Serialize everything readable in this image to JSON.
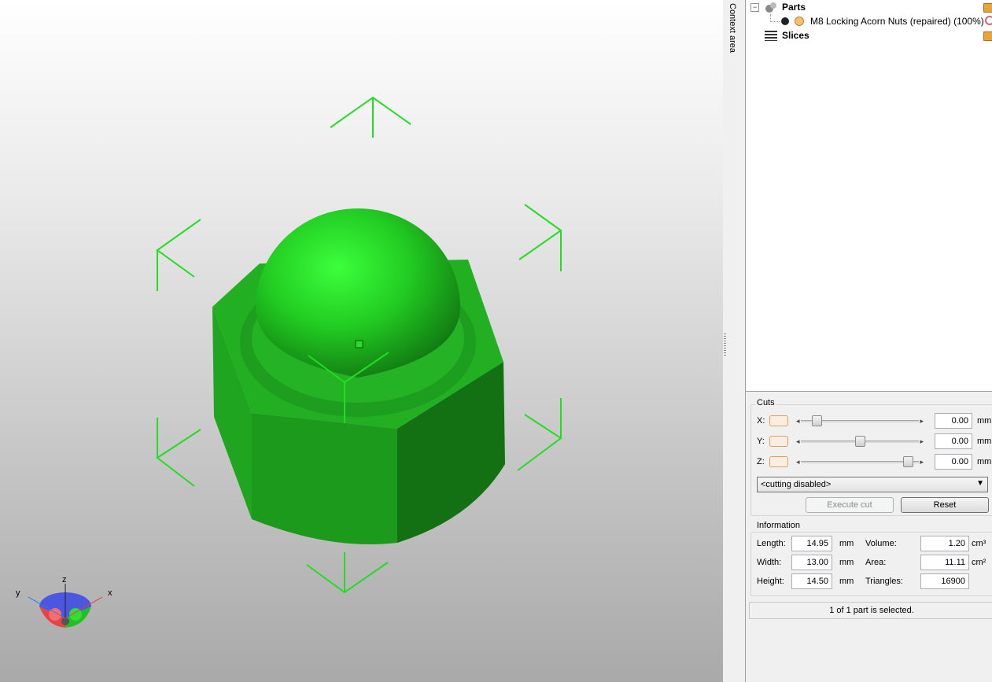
{
  "context_area_label": "Context area",
  "tree": {
    "parts_label": "Parts",
    "part_item": "M8 Locking Acorn Nuts (repaired) (100%)",
    "slices_label": "Slices",
    "expander_symbol": "−"
  },
  "cuts": {
    "title": "Cuts",
    "axes": [
      {
        "label": "X:",
        "value": "0.00",
        "unit": "mm",
        "slider_position": 0.1
      },
      {
        "label": "Y:",
        "value": "0.00",
        "unit": "mm",
        "slider_position": 0.5
      },
      {
        "label": "Z:",
        "value": "0.00",
        "unit": "mm",
        "slider_position": 0.95
      }
    ],
    "mode_select": "<cutting disabled>",
    "execute_label": "Execute cut",
    "reset_label": "Reset"
  },
  "information": {
    "title": "Information",
    "length_label": "Length:",
    "length_value": "14.95",
    "length_unit": "mm",
    "width_label": "Width:",
    "width_value": "13.00",
    "width_unit": "mm",
    "height_label": "Height:",
    "height_value": "14.50",
    "height_unit": "mm",
    "volume_label": "Volume:",
    "volume_value": "1.20",
    "volume_unit": "cm³",
    "area_label": "Area:",
    "area_value": "11.11",
    "area_unit": "cm²",
    "triangles_label": "Triangles:",
    "triangles_value": "16900"
  },
  "status_text": "1 of 1 part is selected.",
  "gizmo": {
    "x_label": "x",
    "y_label": "y",
    "z_label": "z"
  },
  "colors": {
    "model_green": "#22b022",
    "handle_green": "#22dd22",
    "slider_accent": "#e0a060"
  }
}
